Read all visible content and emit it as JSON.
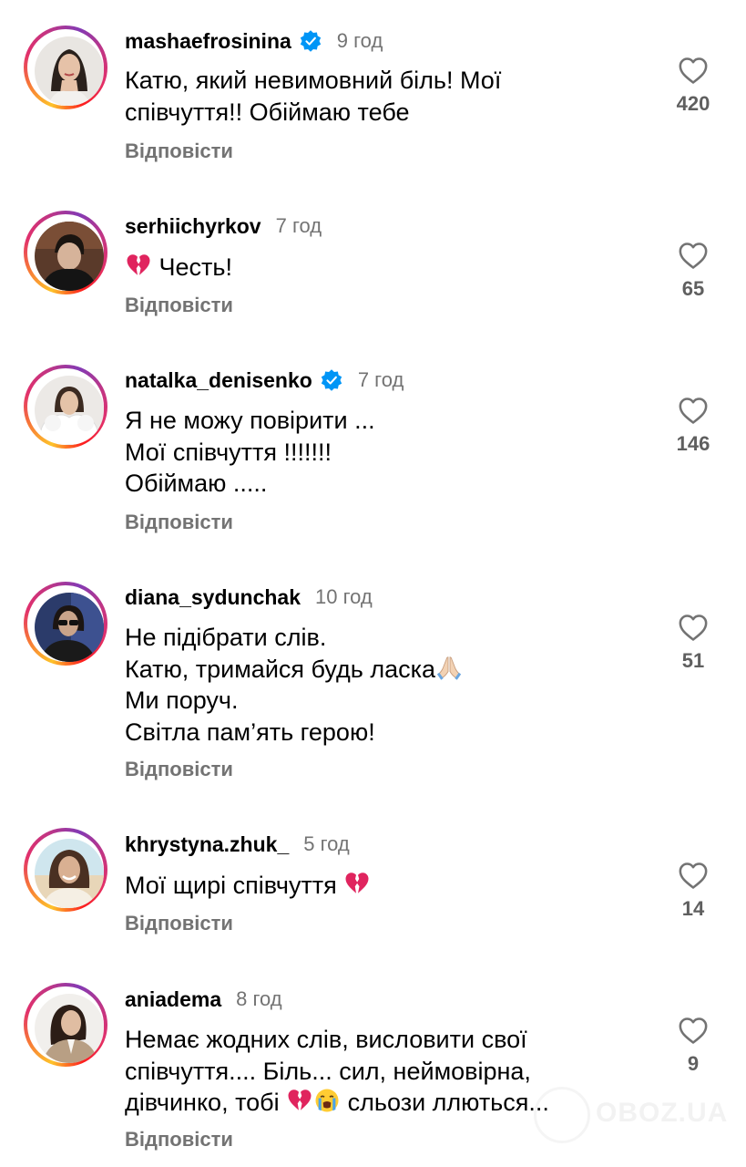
{
  "comments": [
    {
      "username": "mashaefrosinina",
      "verified": true,
      "time": "9 год",
      "lines": [
        "Катю, який невимовний біль! Мої",
        "співчуття!! Обіймаю тебе"
      ],
      "reply_label": "Відповісти",
      "likes": "420"
    },
    {
      "username": "serhiichyrkov",
      "verified": false,
      "time": "7 год",
      "lines": [
        "Честь!"
      ],
      "reply_label": "Відповісти",
      "likes": "65"
    },
    {
      "username": "natalka_denisenko",
      "verified": true,
      "time": "7 год",
      "lines": [
        "Я не можу повірити ...",
        "Мої співчуття !!!!!!!",
        "Обіймаю ....."
      ],
      "reply_label": "Відповісти",
      "likes": "146"
    },
    {
      "username": "diana_sydunchak",
      "verified": false,
      "time": "10 год",
      "lines": [
        "Не підібрати слів.",
        "Катю, тримайся будь ласка",
        "Ми поруч.",
        "Світла пам’ять герою!"
      ],
      "reply_label": "Відповісти",
      "likes": "51"
    },
    {
      "username": "khrystyna.zhuk_",
      "verified": false,
      "time": "5 год",
      "lines": [
        "Мої щирі співчуття"
      ],
      "reply_label": "Відповісти",
      "likes": "14"
    },
    {
      "username": "aniadema",
      "verified": false,
      "time": "8 год",
      "lines": [
        "Немає жодних слів, висловити свої",
        "співчуття.... Біль... сил, неймовірна,",
        "дівчинко, тобі",
        "сльози ллються..."
      ],
      "reply_label": "Відповісти",
      "likes": "9"
    }
  ],
  "icons": {
    "like": "heart-outline-icon",
    "verified": "verified-badge-icon",
    "broken_heart": "broken-heart-emoji",
    "praying_hands": "folded-hands-emoji",
    "crying_face": "loudly-crying-face-emoji"
  },
  "colors": {
    "text": "#000000",
    "secondary_text": "#737373",
    "verified_blue": "#0095f6",
    "broken_heart_red": "#e0245e"
  },
  "watermark": "OBOZ.UA"
}
